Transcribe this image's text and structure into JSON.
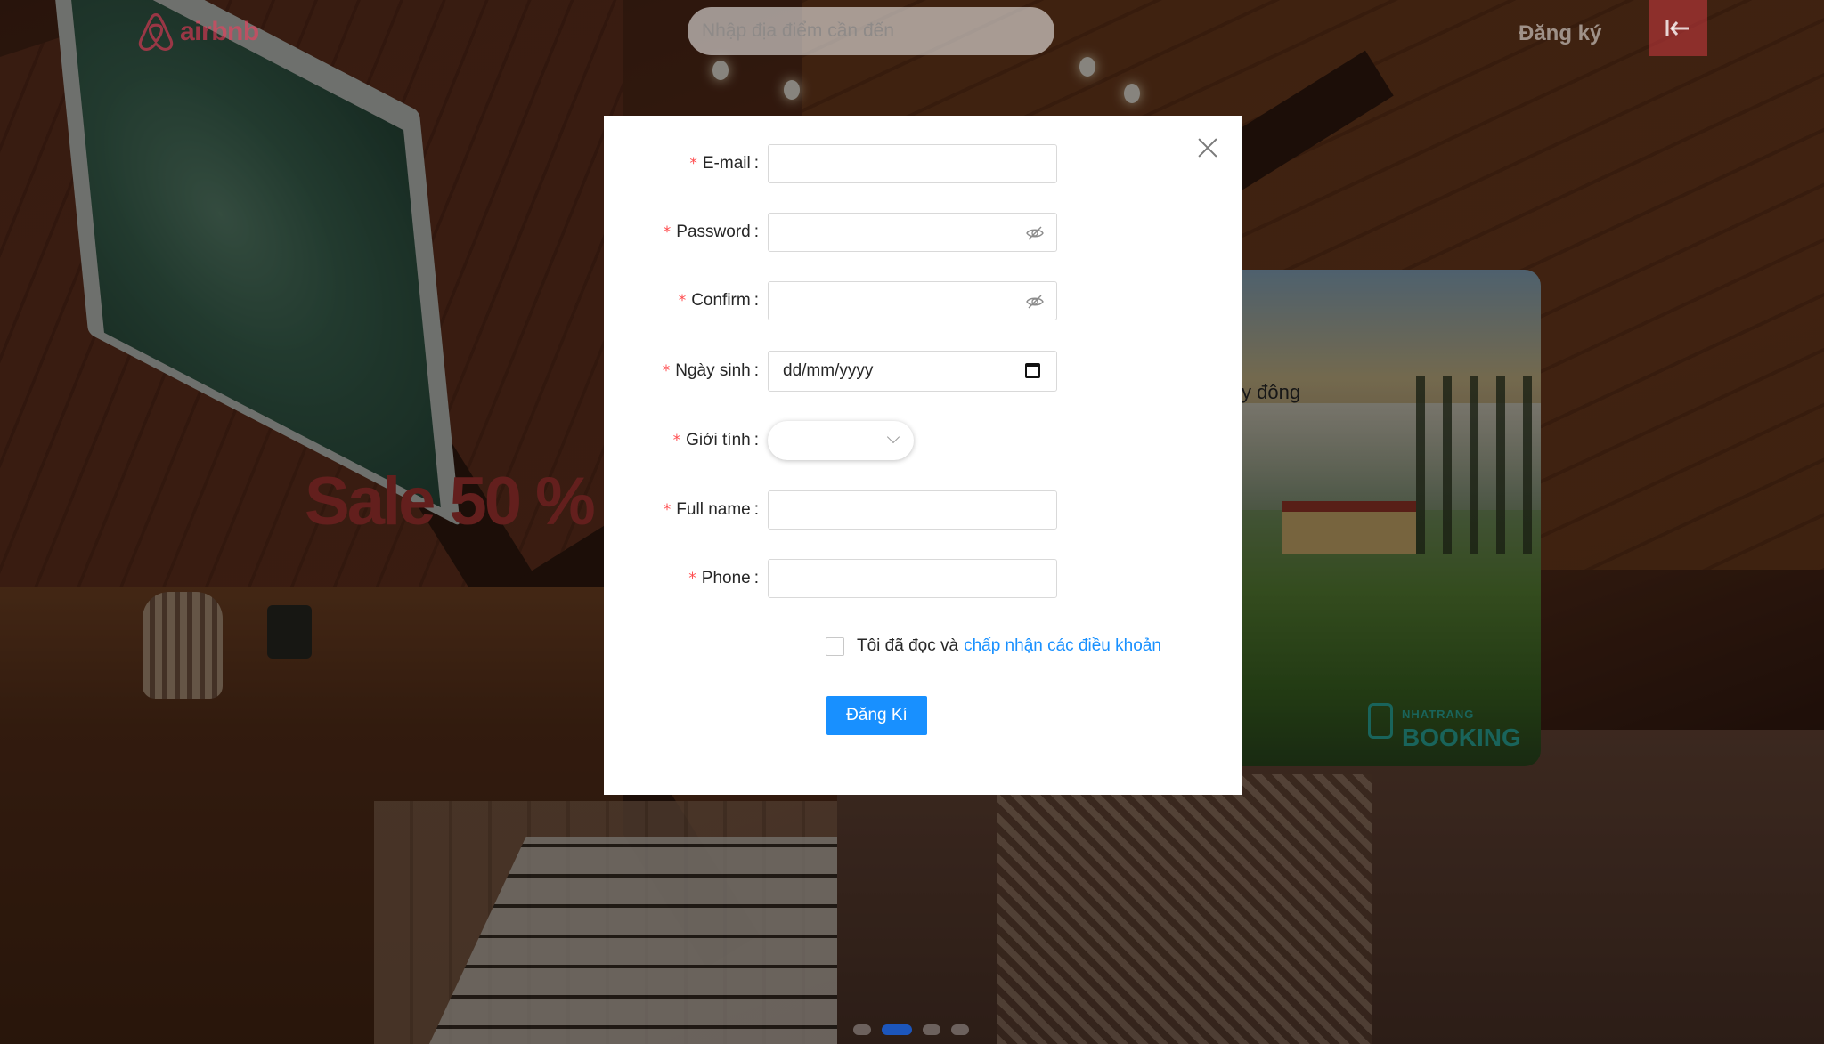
{
  "header": {
    "logo_text": "airbnb",
    "search_placeholder": "Nhập địa điểm cần đến",
    "register_label": "Đăng ký",
    "login_icon": "arrow-left-to-line-icon"
  },
  "banner": {
    "sale_text": "Sale 50 %",
    "promo_text": "y đông",
    "promo_brand_top": "NHATRANG",
    "promo_brand_bottom": "BOOKING"
  },
  "carousel": {
    "active_index": 1,
    "count": 4
  },
  "modal": {
    "fields": [
      {
        "key": "email",
        "label": "E-mail",
        "required": true,
        "value": "",
        "type": "text"
      },
      {
        "key": "password",
        "label": "Password",
        "required": true,
        "value": "",
        "type": "password"
      },
      {
        "key": "confirm",
        "label": "Confirm",
        "required": true,
        "value": "",
        "type": "password"
      },
      {
        "key": "birthday",
        "label": "Ngày sinh",
        "required": true,
        "value": "dd/mm/yyyy",
        "type": "date"
      },
      {
        "key": "gender",
        "label": "Giới tính",
        "required": true,
        "value": "",
        "type": "select"
      },
      {
        "key": "fullname",
        "label": "Full name",
        "required": true,
        "value": "",
        "type": "text"
      },
      {
        "key": "phone",
        "label": "Phone",
        "required": true,
        "value": "",
        "type": "text"
      }
    ],
    "agree_text": "Tôi đã đọc và",
    "terms_link": "chấp nhận các điều khoản",
    "submit_label": "Đăng Kí"
  },
  "colors": {
    "primary": "#1890ff",
    "required_mark": "#ff4d4f",
    "brand": "#ff385c",
    "sale_text": "#b53a36"
  }
}
